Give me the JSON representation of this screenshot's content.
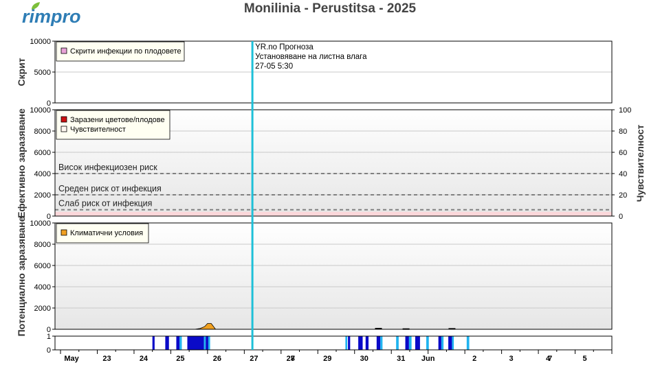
{
  "brand": {
    "logo_text": "rimpro",
    "logo_color": "#2e7db5",
    "leaf_color": "#7cbf3a"
  },
  "title": "Monilinia - Perustitsa - 2025",
  "colors": {
    "forecast_line": "#1ec0d8",
    "infected": "#cc1111",
    "susceptibility_fill": "#fbd7da",
    "climate": "#f0a020",
    "hidden_legend": "#e9a3d7",
    "wet_dark": "#0a0ac8",
    "wet_light": "#20b4f0",
    "grid": "#c8c8c8"
  },
  "forecast": {
    "label_line1": "YR.no Прогноза",
    "label_line2": "Установяване на листна влага",
    "label_line3": "27-05 5:30",
    "x": 27.22
  },
  "chart_data": [
    {
      "id": "hidden",
      "type": "area",
      "ylabel": "Скрит",
      "ylim": [
        0,
        10000
      ],
      "yticks": [
        0,
        5000,
        10000
      ],
      "legend": [
        "Скрити инфекции по плодовете"
      ],
      "grid": true,
      "series": []
    },
    {
      "id": "effective",
      "type": "area",
      "ylabel": "Ефективно заразяване",
      "ylabel_right": "Чувствителност",
      "ylim": [
        0,
        10000
      ],
      "ylim_right": [
        0,
        100
      ],
      "yticks": [
        0,
        2000,
        4000,
        6000,
        8000,
        10000
      ],
      "yticks_right": [
        0,
        20,
        40,
        60,
        80,
        100
      ],
      "legend": [
        "Заразени цветове/плодове",
        "Чувствителност"
      ],
      "risk_levels": [
        {
          "label": "Висок инфекциозен риск",
          "value": 4000
        },
        {
          "label": "Среден риск от инфекция",
          "value": 2000
        },
        {
          "label": "Слаб риск от инфекция",
          "value": 600
        }
      ],
      "susceptibility_level": 4,
      "grid": true
    },
    {
      "id": "potential",
      "type": "area",
      "ylabel": "Потенциално заразяване",
      "ylim": [
        0,
        10000
      ],
      "yticks": [
        0,
        2000,
        4000,
        6000,
        8000,
        10000
      ],
      "legend": [
        "Климатични условия"
      ],
      "grid": true,
      "series": [
        {
          "x": 25.65,
          "y": 0
        },
        {
          "x": 25.8,
          "y": 80
        },
        {
          "x": 25.92,
          "y": 250
        },
        {
          "x": 26.0,
          "y": 550
        },
        {
          "x": 26.1,
          "y": 550
        },
        {
          "x": 26.22,
          "y": 0
        }
      ],
      "small_marks": [
        {
          "x": 30.65,
          "y": 60
        },
        {
          "x": 31.4,
          "y": 20
        },
        {
          "x": 32.65,
          "y": 40
        }
      ]
    },
    {
      "id": "wetness",
      "type": "bar",
      "ylim": [
        0,
        1
      ],
      "yticks": [
        0,
        1
      ],
      "intervals": [
        {
          "start": 24.5,
          "end": 24.56,
          "kind": "dark"
        },
        {
          "start": 24.85,
          "end": 24.95,
          "kind": "dark"
        },
        {
          "start": 25.15,
          "end": 25.24,
          "kind": "dark"
        },
        {
          "start": 25.24,
          "end": 25.3,
          "kind": "light"
        },
        {
          "start": 25.45,
          "end": 25.9,
          "kind": "dark"
        },
        {
          "start": 25.9,
          "end": 25.95,
          "kind": "light"
        },
        {
          "start": 25.95,
          "end": 26.02,
          "kind": "dark"
        },
        {
          "start": 26.02,
          "end": 26.07,
          "kind": "light"
        },
        {
          "start": 29.75,
          "end": 29.8,
          "kind": "light"
        },
        {
          "start": 29.82,
          "end": 29.88,
          "kind": "dark"
        },
        {
          "start": 30.1,
          "end": 30.22,
          "kind": "dark"
        },
        {
          "start": 30.3,
          "end": 30.38,
          "kind": "dark"
        },
        {
          "start": 30.6,
          "end": 30.7,
          "kind": "dark"
        },
        {
          "start": 30.7,
          "end": 30.76,
          "kind": "light"
        },
        {
          "start": 31.13,
          "end": 31.2,
          "kind": "light"
        },
        {
          "start": 31.38,
          "end": 31.48,
          "kind": "dark"
        },
        {
          "start": 31.48,
          "end": 31.55,
          "kind": "light"
        },
        {
          "start": 31.65,
          "end": 31.78,
          "kind": "dark"
        },
        {
          "start": 31.95,
          "end": 32.02,
          "kind": "light"
        },
        {
          "start": 32.28,
          "end": 32.36,
          "kind": "dark"
        },
        {
          "start": 32.36,
          "end": 32.42,
          "kind": "light"
        },
        {
          "start": 32.55,
          "end": 32.65,
          "kind": "dark"
        },
        {
          "start": 32.65,
          "end": 32.7,
          "kind": "light"
        },
        {
          "start": 33.05,
          "end": 33.12,
          "kind": "light"
        }
      ]
    }
  ],
  "x_axis": {
    "xlim": [
      21.85,
      37.0
    ],
    "ticks": [
      {
        "x": 22.3,
        "label": "May"
      },
      {
        "x": 23,
        "label": "23"
      },
      {
        "x": 24,
        "label": "24"
      },
      {
        "x": 25,
        "label": "25"
      },
      {
        "x": 26,
        "label": "26"
      },
      {
        "x": 27,
        "label": "27"
      },
      {
        "x": 28,
        "label": "28"
      },
      {
        "x": 28.32,
        "label": "7"
      },
      {
        "x": 29,
        "label": "29"
      },
      {
        "x": 30,
        "label": "30"
      },
      {
        "x": 31,
        "label": "31"
      },
      {
        "x": 32,
        "label": "Jun"
      },
      {
        "x": 33,
        "label": "2"
      },
      {
        "x": 34,
        "label": "3"
      },
      {
        "x": 35,
        "label": "4"
      },
      {
        "x": 35.32,
        "label": "7"
      },
      {
        "x": 36,
        "label": "5"
      }
    ]
  }
}
